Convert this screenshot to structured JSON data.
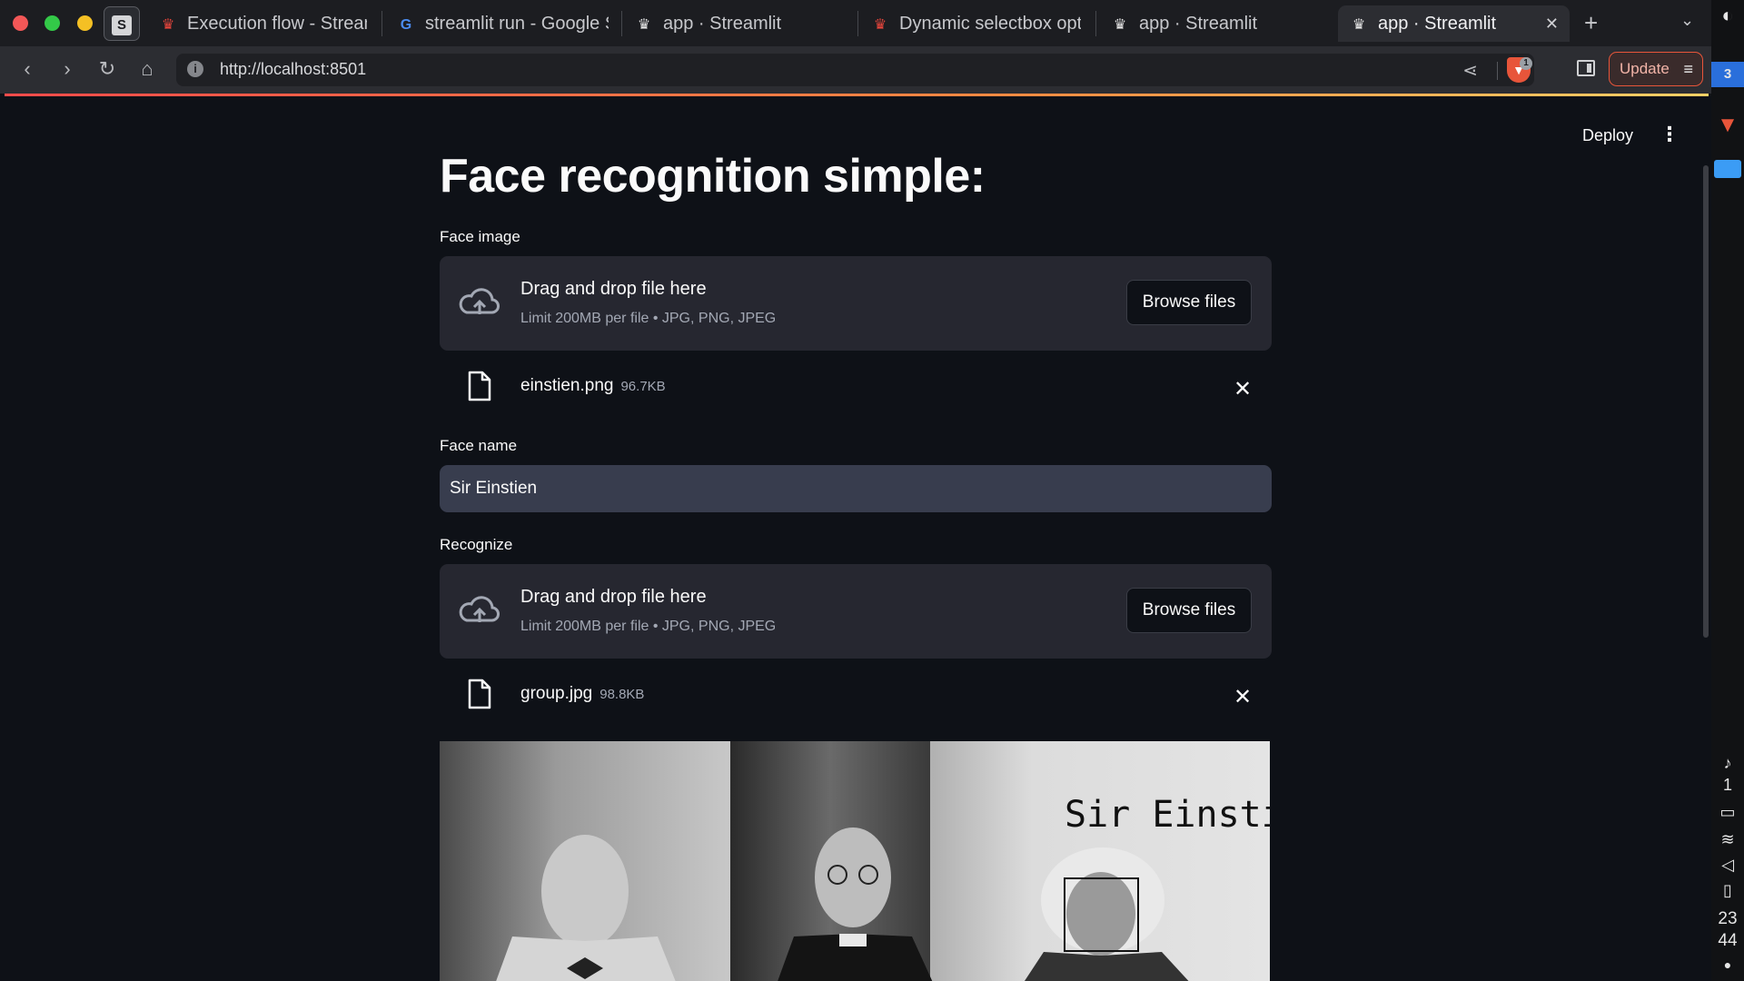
{
  "browser": {
    "tabs": [
      {
        "title": "Execution flow - Streamlit",
        "icon": "streamlit-crown-icon"
      },
      {
        "title": "streamlit run - Google Search",
        "icon": "google-icon"
      },
      {
        "title": "app · Streamlit",
        "icon": "streamlit-crown-icon"
      },
      {
        "title": "Dynamic selectbox options",
        "icon": "streamlit-crown-icon"
      },
      {
        "title": "app · Streamlit",
        "icon": "streamlit-crown-icon"
      },
      {
        "title": "app · Streamlit",
        "icon": "streamlit-crown-icon",
        "active": true
      }
    ],
    "url": "http://localhost:8501",
    "shield_count": "1",
    "update_label": "Update",
    "accent_color": "#ff4b4b"
  },
  "os": {
    "notification_count": "1",
    "workspace": "3",
    "clock_hour": "23",
    "clock_minute": "44"
  },
  "header": {
    "deploy_label": "Deploy"
  },
  "main": {
    "title": "Face recognition simple:",
    "uploader1": {
      "label": "Face image",
      "drag_text": "Drag and drop file here",
      "limit_text": "Limit 200MB per file • JPG, PNG, JPEG",
      "browse_label": "Browse files",
      "file": {
        "name": "einstien.png",
        "size": "96.7KB"
      }
    },
    "name_field": {
      "label": "Face name",
      "value": "Sir Einstien"
    },
    "uploader2": {
      "label": "Recognize",
      "drag_text": "Drag and drop file here",
      "limit_text": "Limit 200MB per file • JPG, PNG, JPEG",
      "browse_label": "Browse files",
      "file": {
        "name": "group.jpg",
        "size": "98.8KB"
      }
    },
    "result_image": {
      "face_label": "Sir Einstien"
    }
  }
}
